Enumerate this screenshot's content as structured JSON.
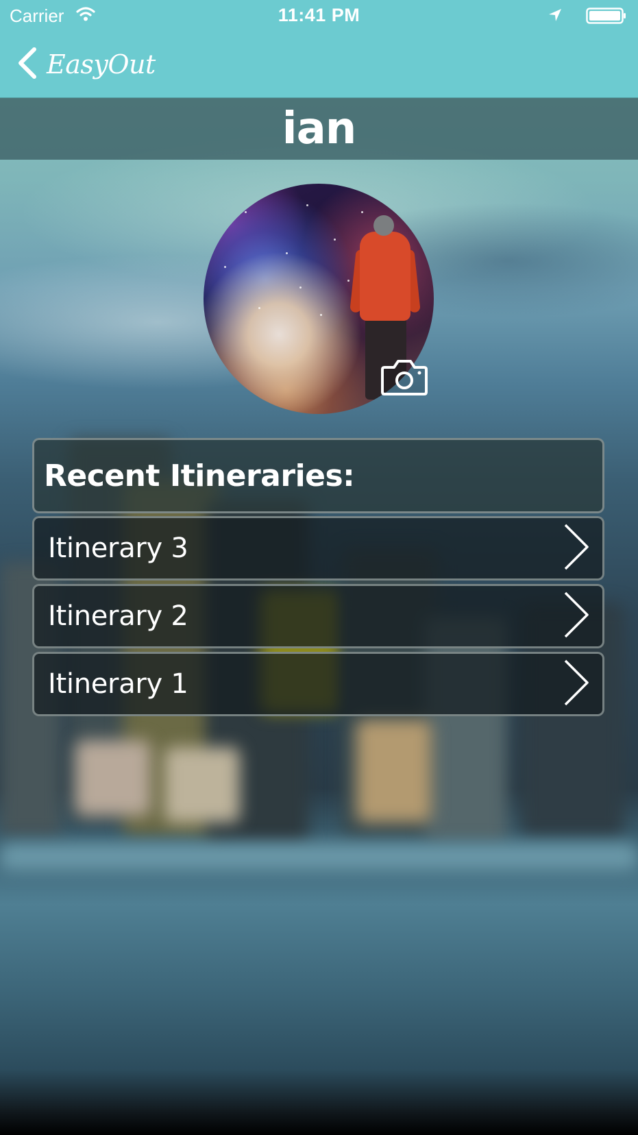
{
  "status_bar": {
    "carrier": "Carrier",
    "time": "11:41 PM",
    "icons": [
      "wifi-icon",
      "location-arrow-icon",
      "battery-icon"
    ]
  },
  "nav_bar": {
    "back_label": "EasyOut",
    "back_icon": "chevron-left-icon",
    "accent_color": "#6ccbd0"
  },
  "profile": {
    "name": "ian",
    "avatar_alt_icon": "camera-icon"
  },
  "itineraries": {
    "header": "Recent Itineraries:",
    "items": [
      {
        "label": "Itinerary 3",
        "icon": "chevron-right-icon"
      },
      {
        "label": "Itinerary 2",
        "icon": "chevron-right-icon"
      },
      {
        "label": "Itinerary 1",
        "icon": "chevron-right-icon"
      }
    ]
  }
}
